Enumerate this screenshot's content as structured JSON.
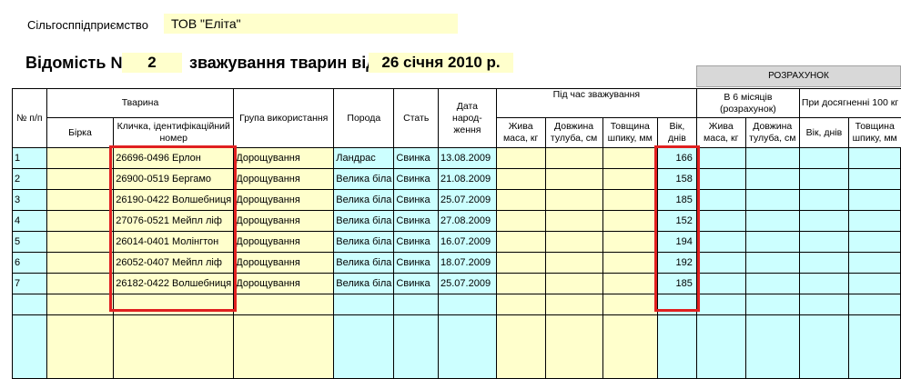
{
  "header": {
    "enterprise_label": "Сільгосппідприємство",
    "enterprise_value": "ТОВ \"Еліта\"",
    "title_label": "Відомість №",
    "title_number": "2",
    "title_mid": "зважування тварин  від",
    "title_date": "26 січня 2010 р.",
    "calc_label": "РОЗРАХУНОК"
  },
  "columns": {
    "num": "№ п/п",
    "animal": "Тварина",
    "tag": "Бірка",
    "nickname": "Кличка, ідентифікаційний номер",
    "group": "Група використання",
    "breed": "Порода",
    "sex": "Стать",
    "birth": "Дата народ-ження",
    "weighing": "Під час зважування",
    "live_mass": "Жива маса, кг",
    "body_len": "Довжина тулуба, см",
    "fat": "Товщина шпику, мм",
    "age": "Вік, днів",
    "six_months": "В 6 місяців (розрахунок)",
    "six_live_mass": "Жива маса, кг",
    "six_body_len": "Довжина тулуба, см",
    "hundred": "При досягненні 100 кг",
    "hundred_age": "Вік, днів",
    "hundred_fat": "Товщина шпику, мм"
  },
  "rows": [
    {
      "n": "1",
      "name": "26696-0496 Ерлон",
      "group": "Дорощування",
      "breed": "Ландрас",
      "sex": "Свинка",
      "birth": "13.08.2009",
      "age": "166"
    },
    {
      "n": "2",
      "name": "26900-0519 Бергамо",
      "group": "Дорощування",
      "breed": "Велика біла",
      "sex": "Свинка",
      "birth": "21.08.2009",
      "age": "158"
    },
    {
      "n": "3",
      "name": "26190-0422 Волшебниця",
      "group": "Дорощування",
      "breed": "Велика біла",
      "sex": "Свинка",
      "birth": "25.07.2009",
      "age": "185"
    },
    {
      "n": "4",
      "name": "27076-0521  Мейпл ліф",
      "group": "Дорощування",
      "breed": "Велика біла",
      "sex": "Свинка",
      "birth": "27.08.2009",
      "age": "152"
    },
    {
      "n": "5",
      "name": "26014-0401  Молінгтон",
      "group": "Дорощування",
      "breed": "Велика біла",
      "sex": "Свинка",
      "birth": "16.07.2009",
      "age": "194"
    },
    {
      "n": "6",
      "name": "26052-0407  Мейпл ліф",
      "group": "Дорощування",
      "breed": "Велика біла",
      "sex": "Свинка",
      "birth": "18.07.2009",
      "age": "192"
    },
    {
      "n": "7",
      "name": "26182-0422 Волшебниця",
      "group": "Дорощування",
      "breed": "Велика біла",
      "sex": "Свинка",
      "birth": "25.07.2009",
      "age": "185"
    }
  ],
  "highlight_color": "#e02020",
  "cell_colors": {
    "cyan": "#ccffff",
    "yellow": "#ffffcc"
  }
}
